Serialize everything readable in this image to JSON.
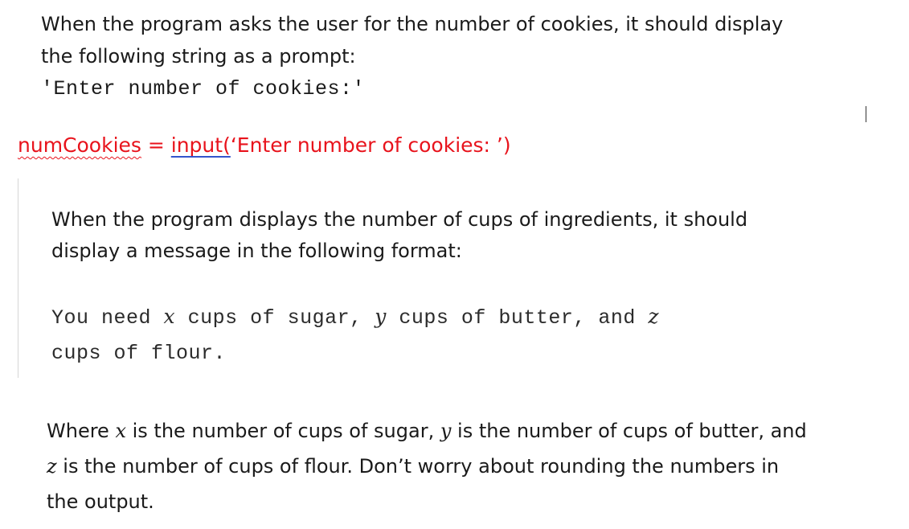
{
  "prompt_section": {
    "instruction_line1": "When the program asks the user for the number of cookies, it should display",
    "instruction_line2": "the following string as a prompt:",
    "prompt_string": "'Enter number of cookies:'"
  },
  "code": {
    "var_name": "numCookies",
    "operator": " = ",
    "func": "input(",
    "argument": "‘Enter number of cookies: ’)"
  },
  "output_section": {
    "instruction_line1": "When the program displays the number of cups of ingredients, it should",
    "instruction_line2": "display a message in the following format:",
    "sample_line1_a": "You need ",
    "sample_x": "x",
    "sample_line1_b": " cups of sugar, ",
    "sample_y": "y",
    "sample_line1_c": " cups of butter, and ",
    "sample_z": "z",
    "sample_line2": "cups of flour."
  },
  "explanation": {
    "l1_a": "Where ",
    "x": "x",
    "l1_b": " is the number of cups of sugar, ",
    "y": "y",
    "l1_c": " is the number of cups of butter, and",
    "z": "z",
    "l2": " is the number of cups of flour. Don’t worry about rounding the numbers in",
    "l3": "the output."
  }
}
